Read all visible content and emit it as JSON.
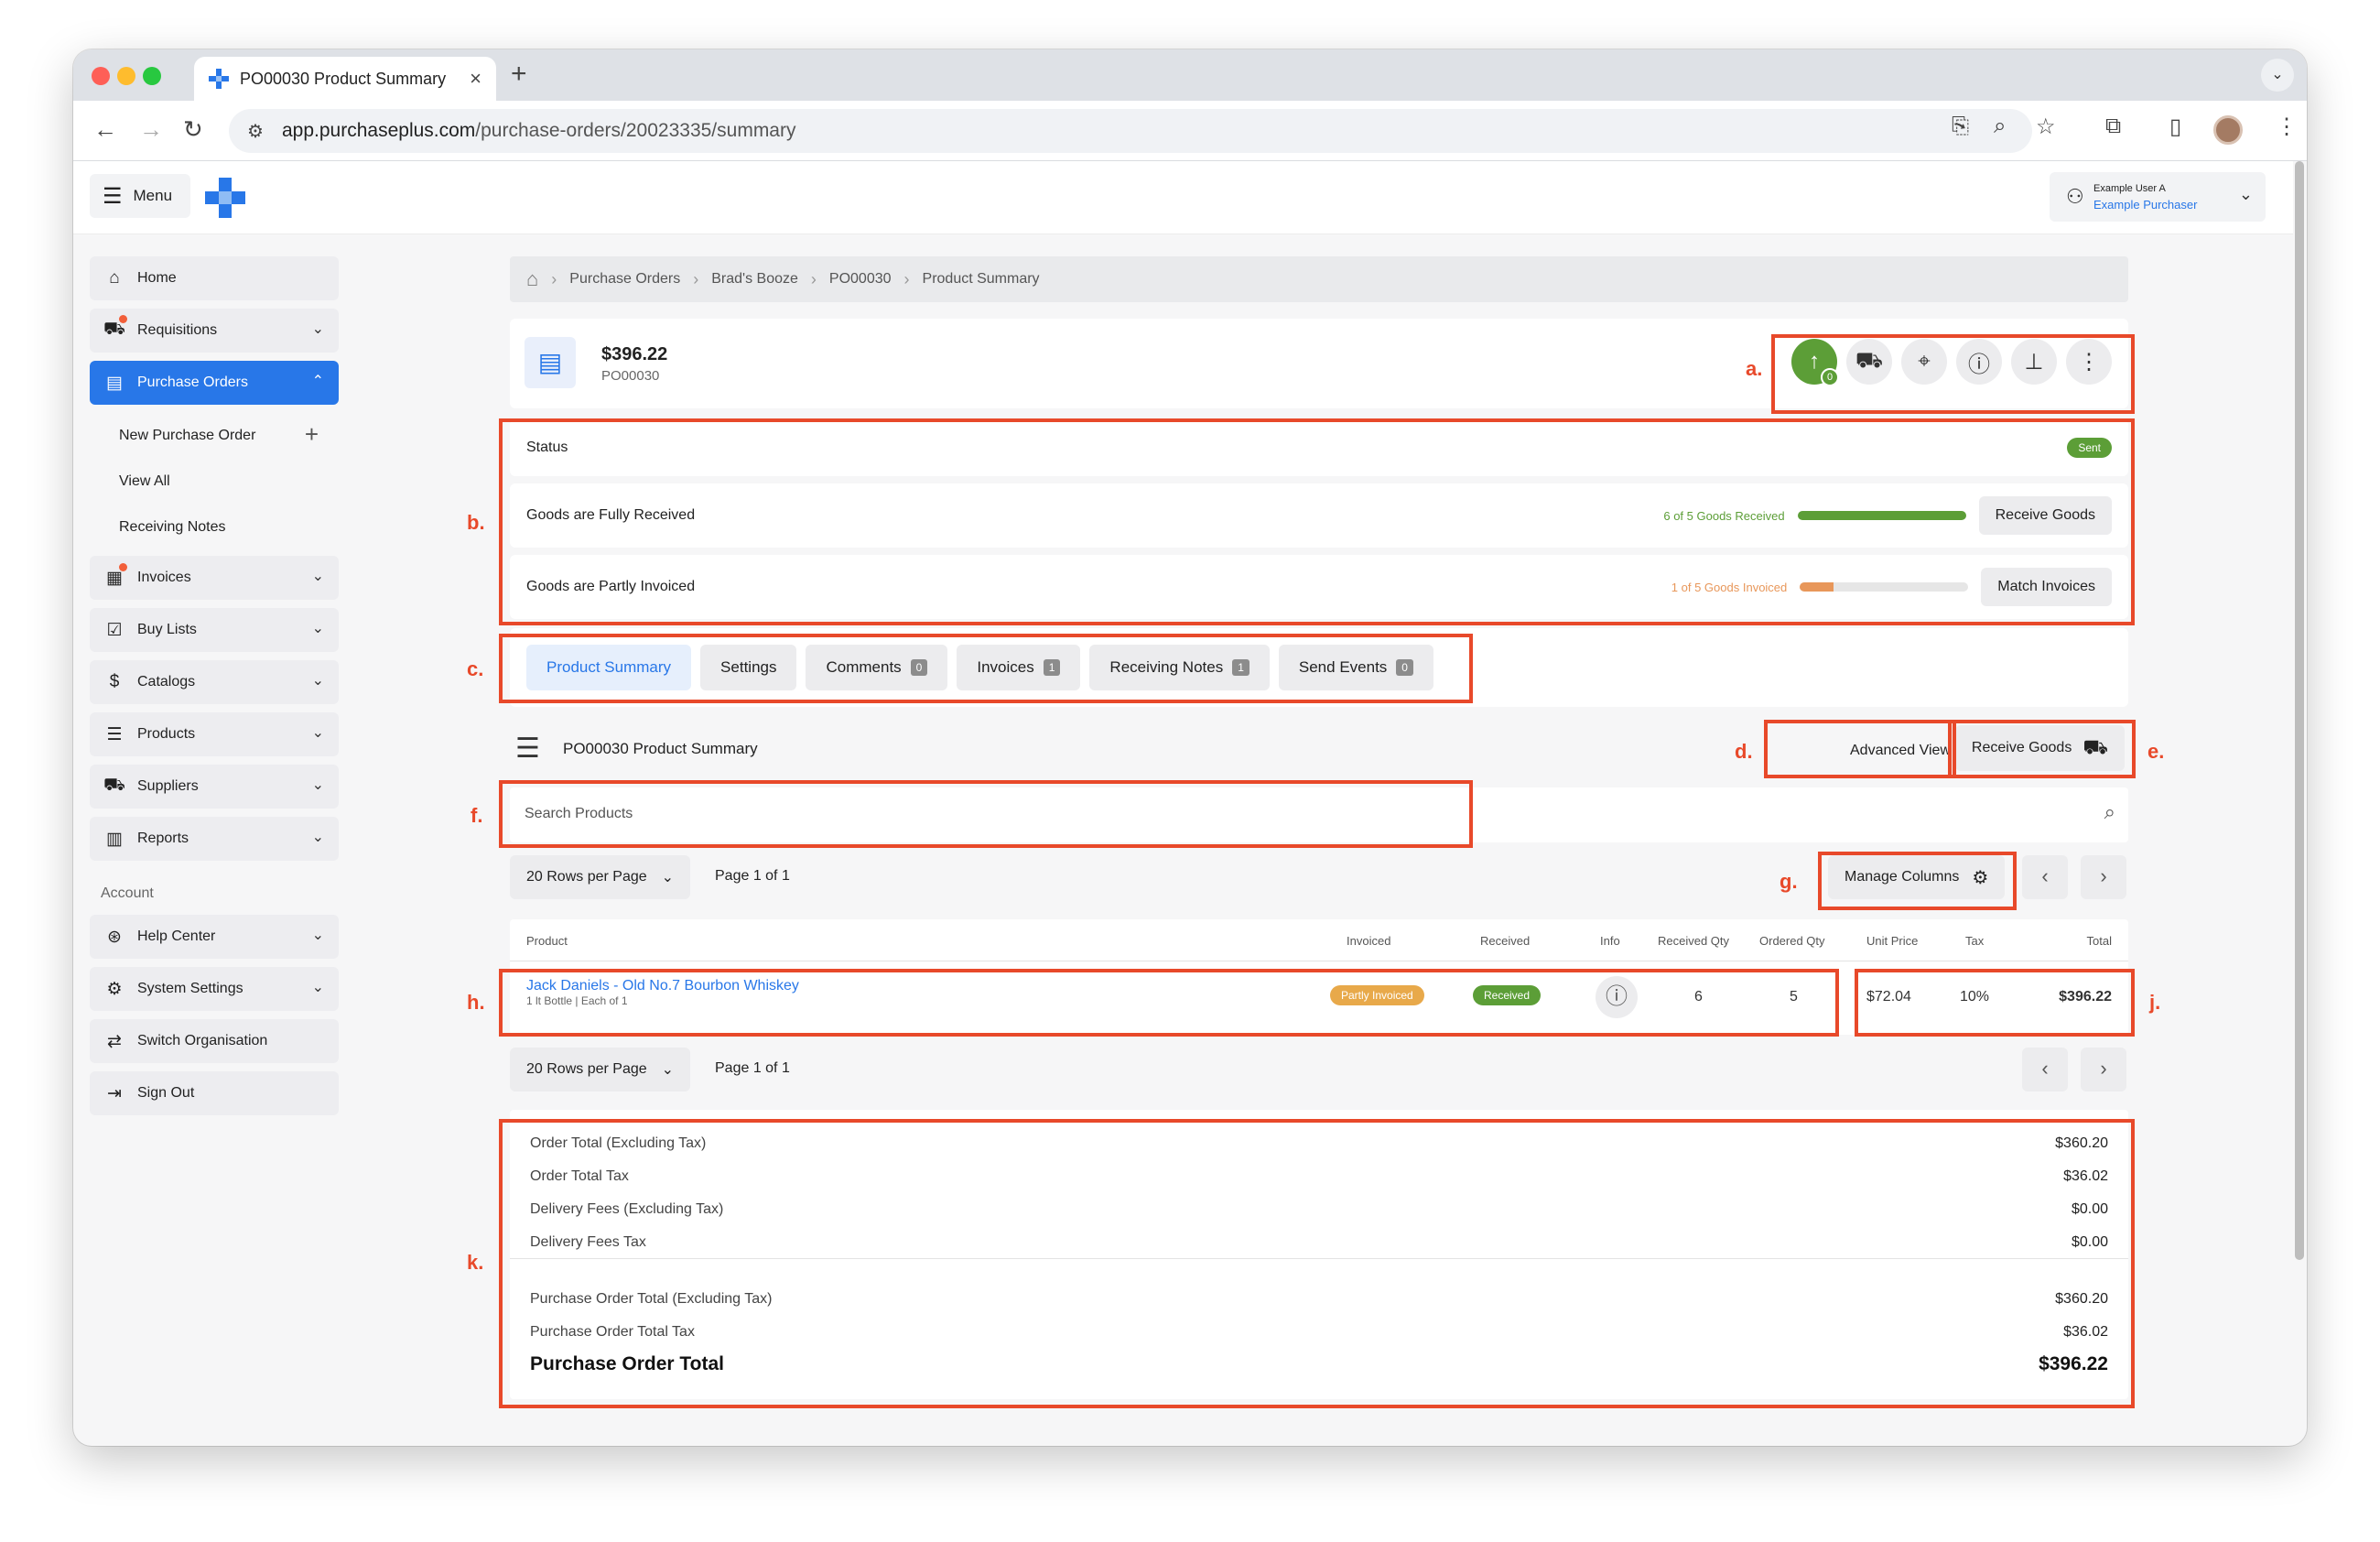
{
  "browser": {
    "tab_title": "PO00030 Product Summary",
    "url_host": "app.purchaseplus.com",
    "url_path": "/purchase-orders/20023335/summary"
  },
  "header": {
    "menu_label": "Menu",
    "user_name": "Example User A",
    "user_role": "Example Purchaser"
  },
  "sidebar": {
    "items": [
      {
        "label": "Home",
        "icon": "home-icon"
      },
      {
        "label": "Requisitions",
        "icon": "cart-icon"
      },
      {
        "label": "Purchase Orders",
        "icon": "clipboard-icon",
        "active": true
      },
      {
        "label": "New Purchase Order"
      },
      {
        "label": "View All"
      },
      {
        "label": "Receiving Notes"
      },
      {
        "label": "Invoices",
        "icon": "invoice-icon"
      },
      {
        "label": "Buy Lists",
        "icon": "checklist-icon"
      },
      {
        "label": "Catalogs",
        "icon": "catalog-icon"
      },
      {
        "label": "Products",
        "icon": "products-icon"
      },
      {
        "label": "Suppliers",
        "icon": "truck-icon"
      },
      {
        "label": "Reports",
        "icon": "chart-icon"
      }
    ],
    "section": "Account",
    "account_items": [
      {
        "label": "Help Center"
      },
      {
        "label": "System Settings"
      },
      {
        "label": "Switch Organisation"
      },
      {
        "label": "Sign Out"
      }
    ]
  },
  "breadcrumb": [
    "Purchase Orders",
    "Brad's Booze",
    "PO00030",
    "Product Summary"
  ],
  "po": {
    "amount": "$396.22",
    "id": "PO00030",
    "sent_count": "0"
  },
  "status": {
    "label": "Status",
    "badge": "Sent",
    "badge_color": "#5c9e37",
    "received": {
      "label": "Goods are Fully Received",
      "progress_text": "6 of 5 Goods Received",
      "fill": 1.0,
      "color": "#5c9e37",
      "button": "Receive Goods"
    },
    "invoiced": {
      "label": "Goods are Partly Invoiced",
      "progress_text": "1 of 5 Goods Invoiced",
      "fill": 0.2,
      "color": "#e8975a",
      "button": "Match Invoices"
    }
  },
  "tabs": [
    {
      "label": "Product Summary",
      "active": true
    },
    {
      "label": "Settings"
    },
    {
      "label": "Comments",
      "count": "0"
    },
    {
      "label": "Invoices",
      "count": "1"
    },
    {
      "label": "Receiving Notes",
      "count": "1"
    },
    {
      "label": "Send Events",
      "count": "0"
    }
  ],
  "summary": {
    "title": "PO00030 Product Summary",
    "advanced_view": "Advanced View",
    "receive_goods": "Receive Goods",
    "search_placeholder": "Search Products",
    "rows_per_page": "20 Rows per Page",
    "page": "Page 1 of 1",
    "manage_columns": "Manage Columns"
  },
  "table": {
    "columns": [
      "Product",
      "Invoiced",
      "Received",
      "Info",
      "Received Qty",
      "Ordered Qty",
      "Unit Price",
      "Tax",
      "Total"
    ],
    "rows": [
      {
        "product": "Jack Daniels - Old No.7 Bourbon Whiskey",
        "detail": "1 lt Bottle | Each of 1",
        "invoiced": "Partly Invoiced",
        "received": "Received",
        "received_qty": "6",
        "ordered_qty": "5",
        "unit_price": "$72.04",
        "tax": "10%",
        "total": "$396.22"
      }
    ]
  },
  "totals": [
    {
      "label": "Order Total (Excluding Tax)",
      "value": "$360.20"
    },
    {
      "label": "Order Total Tax",
      "value": "$36.02"
    },
    {
      "label": "Delivery Fees (Excluding Tax)",
      "value": "$0.00"
    },
    {
      "label": "Delivery Fees Tax",
      "value": "$0.00"
    },
    {
      "label": "Purchase Order Total (Excluding Tax)",
      "value": "$360.20"
    },
    {
      "label": "Purchase Order Total Tax",
      "value": "$36.02"
    },
    {
      "label": "Purchase Order Total",
      "value": "$396.22"
    }
  ],
  "annotations": [
    "a.",
    "b.",
    "c.",
    "d.",
    "e.",
    "f.",
    "g.",
    "h.",
    "j.",
    "k."
  ],
  "colors": {
    "accent": "#2877e8",
    "annotation": "#e8492a",
    "success": "#5c9e37",
    "warning": "#e8a94a"
  }
}
